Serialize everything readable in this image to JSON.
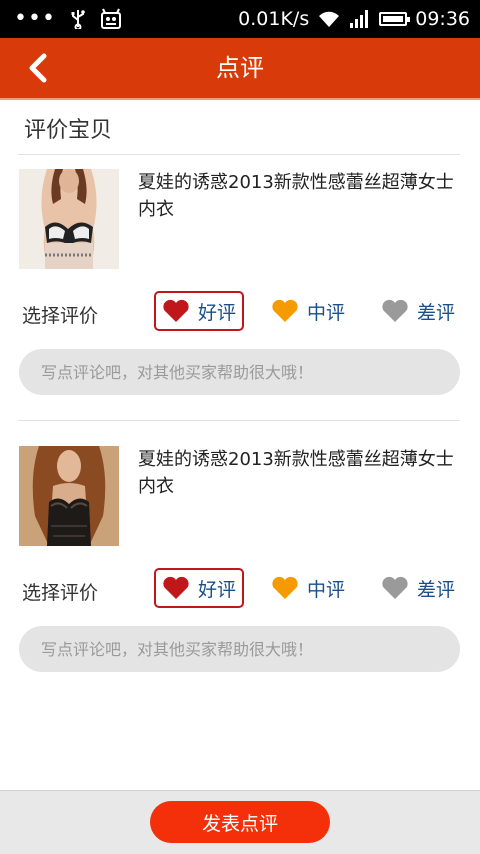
{
  "status_bar": {
    "dots": "•••",
    "speed": "0.01K/s",
    "time": "09:36"
  },
  "header": {
    "title": "点评",
    "back_icon": "chevron-left-icon"
  },
  "section": {
    "title": "评价宝贝"
  },
  "items": [
    {
      "name": "夏娃的诱惑2013新款性感蕾丝超薄女士内衣",
      "rate_label": "选择评价",
      "options": [
        {
          "label": "好评",
          "color": "#c0181a",
          "selected": true
        },
        {
          "label": "中评",
          "color": "#f59b00",
          "selected": false
        },
        {
          "label": "差评",
          "color": "#9a9a9a",
          "selected": false
        }
      ],
      "comment_placeholder": "写点评论吧，对其他买家帮助很大哦！"
    },
    {
      "name": "夏娃的诱惑2013新款性感蕾丝超薄女士内衣",
      "rate_label": "选择评价",
      "options": [
        {
          "label": "好评",
          "color": "#c0181a",
          "selected": true
        },
        {
          "label": "中评",
          "color": "#f59b00",
          "selected": false
        },
        {
          "label": "差评",
          "color": "#9a9a9a",
          "selected": false
        }
      ],
      "comment_placeholder": "写点评论吧，对其他买家帮助很大哦！"
    }
  ],
  "footer": {
    "submit_label": "发表点评"
  },
  "colors": {
    "header": "#d93a0a",
    "submit": "#f3300a",
    "link_text": "#1a4f8a"
  }
}
